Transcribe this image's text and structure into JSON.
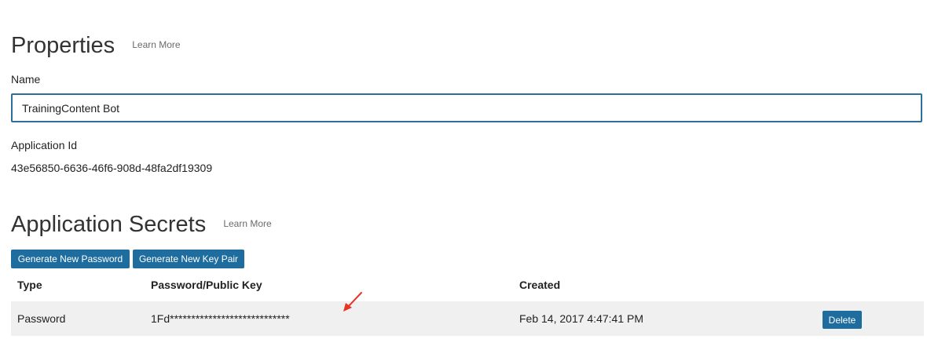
{
  "properties": {
    "title": "Properties",
    "learn_more": "Learn More",
    "name_label": "Name",
    "name_value": "TrainingContent Bot",
    "app_id_label": "Application Id",
    "app_id_value": "43e56850-6636-46f6-908d-48fa2df19309"
  },
  "secrets": {
    "title": "Application Secrets",
    "learn_more": "Learn More",
    "generate_password_label": "Generate New Password",
    "generate_keypair_label": "Generate New Key Pair",
    "columns": {
      "type": "Type",
      "key": "Password/Public Key",
      "created": "Created"
    },
    "rows": [
      {
        "type": "Password",
        "key": "1Fd****************************",
        "created": "Feb 14, 2017 4:47:41 PM",
        "delete_label": "Delete"
      }
    ]
  },
  "colors": {
    "accent": "#1f6d9e",
    "input_border": "#2c6f9a",
    "row_bg": "#f0f0f0",
    "annotation": "#e8332a"
  },
  "annotation_icon": "red-arrow-icon"
}
